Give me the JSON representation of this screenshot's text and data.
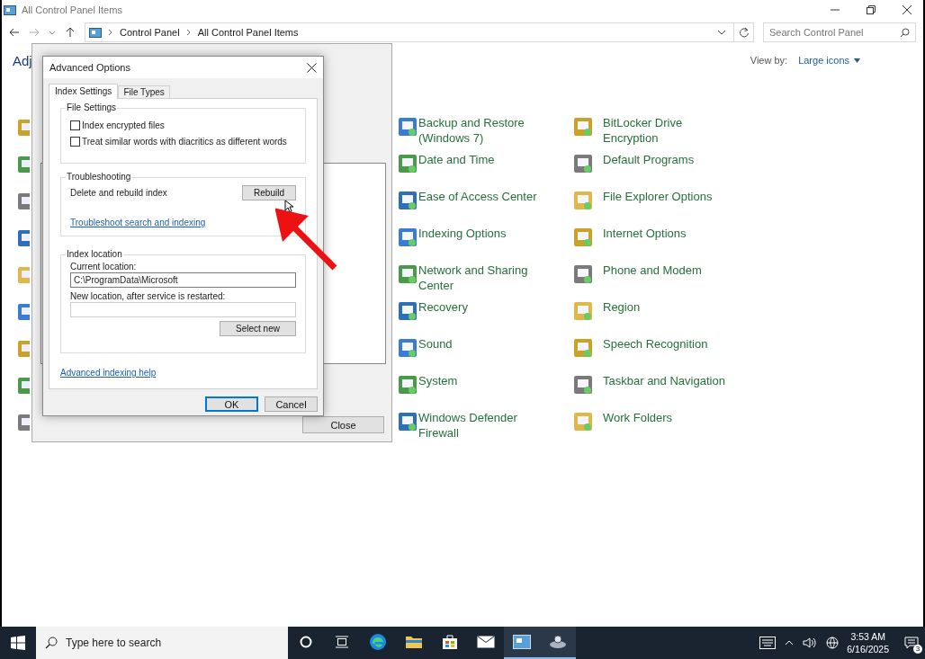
{
  "window": {
    "title": "All Control Panel Items"
  },
  "address_bar": {
    "breadcrumbs": [
      "Control Panel",
      "All Control Panel Items"
    ]
  },
  "search": {
    "placeholder": "Search Control Panel"
  },
  "heading": "Adj",
  "view_by": {
    "label": "View by:",
    "value": "Large icons"
  },
  "items": [
    {
      "label": "Backup and Restore (Windows 7)"
    },
    {
      "label": "BitLocker Drive Encryption"
    },
    {
      "label": "Date and Time"
    },
    {
      "label": "Default Programs"
    },
    {
      "label": "Ease of Access Center"
    },
    {
      "label": "File Explorer Options"
    },
    {
      "label": "Indexing Options"
    },
    {
      "label": "Internet Options"
    },
    {
      "label": "Network and Sharing Center"
    },
    {
      "label": "Phone and Modem"
    },
    {
      "label": "Recovery"
    },
    {
      "label": "Region"
    },
    {
      "label": "Sound"
    },
    {
      "label": "Speech Recognition"
    },
    {
      "label": "System"
    },
    {
      "label": "Taskbar and Navigation"
    },
    {
      "label": "Windows Defender Firewall"
    },
    {
      "label": "Work Folders"
    }
  ],
  "indexing_window": {
    "close_button": "Close"
  },
  "advanced_options": {
    "title": "Advanced Options",
    "tabs": [
      {
        "label": "Index Settings",
        "selected": true
      },
      {
        "label": "File Types",
        "selected": false
      }
    ],
    "file_settings": {
      "legend": "File Settings",
      "options": [
        {
          "label": "Index encrypted files",
          "checked": false
        },
        {
          "label": "Treat similar words with diacritics as different words",
          "checked": false
        }
      ]
    },
    "troubleshooting": {
      "legend": "Troubleshooting",
      "label": "Delete and rebuild index",
      "button": "Rebuild",
      "link": "Troubleshoot search and indexing"
    },
    "index_location": {
      "legend": "Index location",
      "current_label": "Current location:",
      "current_value": "C:\\ProgramData\\Microsoft",
      "new_label": "New location, after service is restarted:",
      "button": "Select new"
    },
    "help_link": "Advanced indexing help",
    "buttons": [
      {
        "label": "OK",
        "default": true
      },
      {
        "label": "Cancel",
        "default": false
      }
    ]
  },
  "taskbar": {
    "search_placeholder": "Type here to search",
    "apps": [
      {
        "kind": "cortana",
        "active": false
      },
      {
        "kind": "taskview",
        "active": false
      },
      {
        "kind": "edge",
        "active": false
      },
      {
        "kind": "folder",
        "active": false
      },
      {
        "kind": "store",
        "active": false
      },
      {
        "kind": "mail",
        "active": false
      },
      {
        "kind": "controlpanel",
        "active": true
      },
      {
        "kind": "indexing",
        "active": true
      }
    ],
    "time": "3:53 AM",
    "date": "6/16/2025",
    "notifications": "3"
  }
}
